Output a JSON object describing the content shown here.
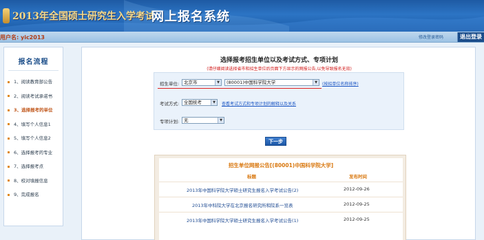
{
  "header": {
    "title": "2013年全国硕士研究生入学考试",
    "system_title": "网上报名系统"
  },
  "userbar": {
    "user_label": "用户名: yic2013",
    "modify_password": "修改登录密码",
    "logout": "退出登录"
  },
  "sidebar": {
    "heading": "报名流程",
    "items": [
      {
        "label": "1、阅读教育部公告"
      },
      {
        "label": "2、阅读考试承诺书"
      },
      {
        "label": "3、选择报考的单位"
      },
      {
        "label": "4、填写个人信息1"
      },
      {
        "label": "5、填写个人信息2"
      },
      {
        "label": "6、选择报考的专业"
      },
      {
        "label": "7、选择报考点"
      },
      {
        "label": "8、校对填报信息"
      },
      {
        "label": "9、完成报名"
      }
    ]
  },
  "main": {
    "heading": "选择报考招生单位以及考试方式、专项计划",
    "notice": "(请仔细阅读选择省市和招生单位后页面下方显示的网报公告,以免导致报名无效)",
    "form": {
      "unit_label": "招生单位:",
      "province_value": "北京市",
      "unit_value": "(80001)中国科学院大学",
      "sort_link": "(按招单位名称排序)",
      "exam_mode_label": "考试方式:",
      "exam_mode_value": "全国统考",
      "exam_mode_link": "查看考试方式和专项计划的解释以及关系",
      "special_plan_label": "专项计划:",
      "special_plan_value": "无"
    },
    "next_button": "下一步"
  },
  "announcement": {
    "title": "招生单位网报公告[(80001)中国科学院大学]",
    "col_title": "标题",
    "col_date": "发布时间",
    "rows": [
      {
        "title": "2013年中国科学院大学硕士研究生报名入学考试公告(2)",
        "date": "2012-09-26"
      },
      {
        "title": "2013年中科院大学在北京报名研究所和院系一览表",
        "date": "2012-09-25"
      },
      {
        "title": "2013年中国科学院大学硕士研究生报名入学考试公告(1)",
        "date": "2012-09-25"
      }
    ]
  }
}
